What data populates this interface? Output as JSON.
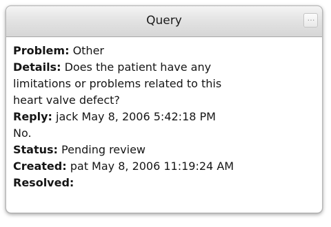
{
  "window": {
    "title": "Query",
    "menu_button": "…"
  },
  "query": {
    "problem_label": "Problem:",
    "problem_value": "Other",
    "details_label": "Details:",
    "details_line1": "Does the patient have any",
    "details_line2": "limitations or problems related to this",
    "details_line3": "heart valve defect?",
    "reply_label": "Reply:",
    "reply_value": "jack May 8, 2006 5:42:18 PM",
    "reply_text": "No.",
    "status_label": "Status:",
    "status_value": "Pending review",
    "created_label": "Created:",
    "created_value": "pat May 8, 2006 11:19:24 AM",
    "resolved_label": "Resolved:",
    "resolved_value": ""
  },
  "icons": {
    "menu": "ellipsis-icon"
  }
}
